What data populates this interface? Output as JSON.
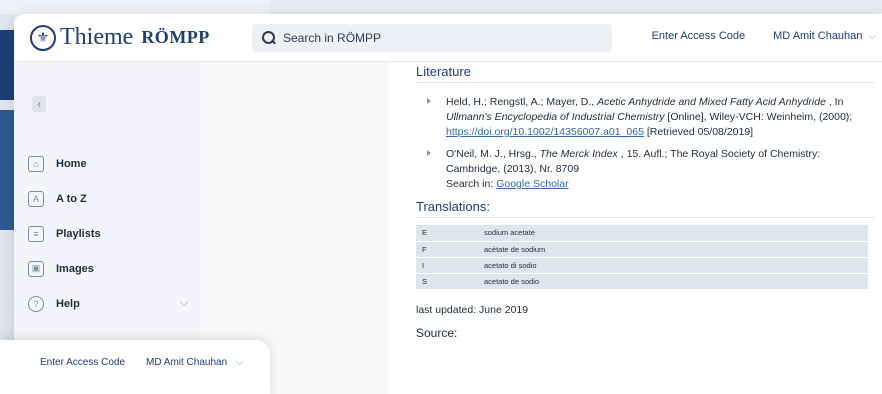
{
  "header": {
    "brand": "Thieme",
    "product": "RÖMPP",
    "search_placeholder": "Search in RÖMPP",
    "access_code": "Enter Access Code",
    "user_name": "MD Amit Chauhan"
  },
  "sidebar": {
    "items": [
      {
        "label": "Home",
        "icon": "home-icon"
      },
      {
        "label": "A to Z",
        "icon": "atoz-icon"
      },
      {
        "label": "Playlists",
        "icon": "playlist-icon"
      },
      {
        "label": "Images",
        "icon": "images-icon"
      },
      {
        "label": "Help",
        "icon": "help-icon"
      }
    ]
  },
  "popcard": {
    "access_code": "Enter Access Code",
    "user_name": "MD Amit Chauhan"
  },
  "main": {
    "literature_heading": "Literature",
    "literature": [
      {
        "pre": "Held, H.; Rengstl, A.; Mayer, D., ",
        "title": "Acetic Anhydride and Mixed Fatty Acid Anhydride",
        "mid": " , In ",
        "source": "Ullmann's Encyclopedia of Industrial Chemistry",
        "post": " [Online], Wiley-VCH: Weinheim, (2000); ",
        "link": "https://doi.org/10.1002/14356007.a01_065",
        "tail": " [Retrieved 05/08/2019]"
      },
      {
        "pre": "O'Neil, M. J., Hrsg., ",
        "title": "The Merck Index",
        "post": " , 15. Aufl.; The Royal Society of Chemistry: Cambridge, (2013), Nr. 8709",
        "search_label": "Search in: ",
        "search_link": "Google Scholar"
      }
    ],
    "translations_heading": "Translations:",
    "translations": [
      {
        "lang": "E",
        "text": "sodium acetate"
      },
      {
        "lang": "F",
        "text": "acétate de sodium"
      },
      {
        "lang": "I",
        "text": "acetato di sodio"
      },
      {
        "lang": "S",
        "text": "acetato de sodio"
      }
    ],
    "last_updated": "last updated: June 2019",
    "source_heading": "Source:"
  }
}
